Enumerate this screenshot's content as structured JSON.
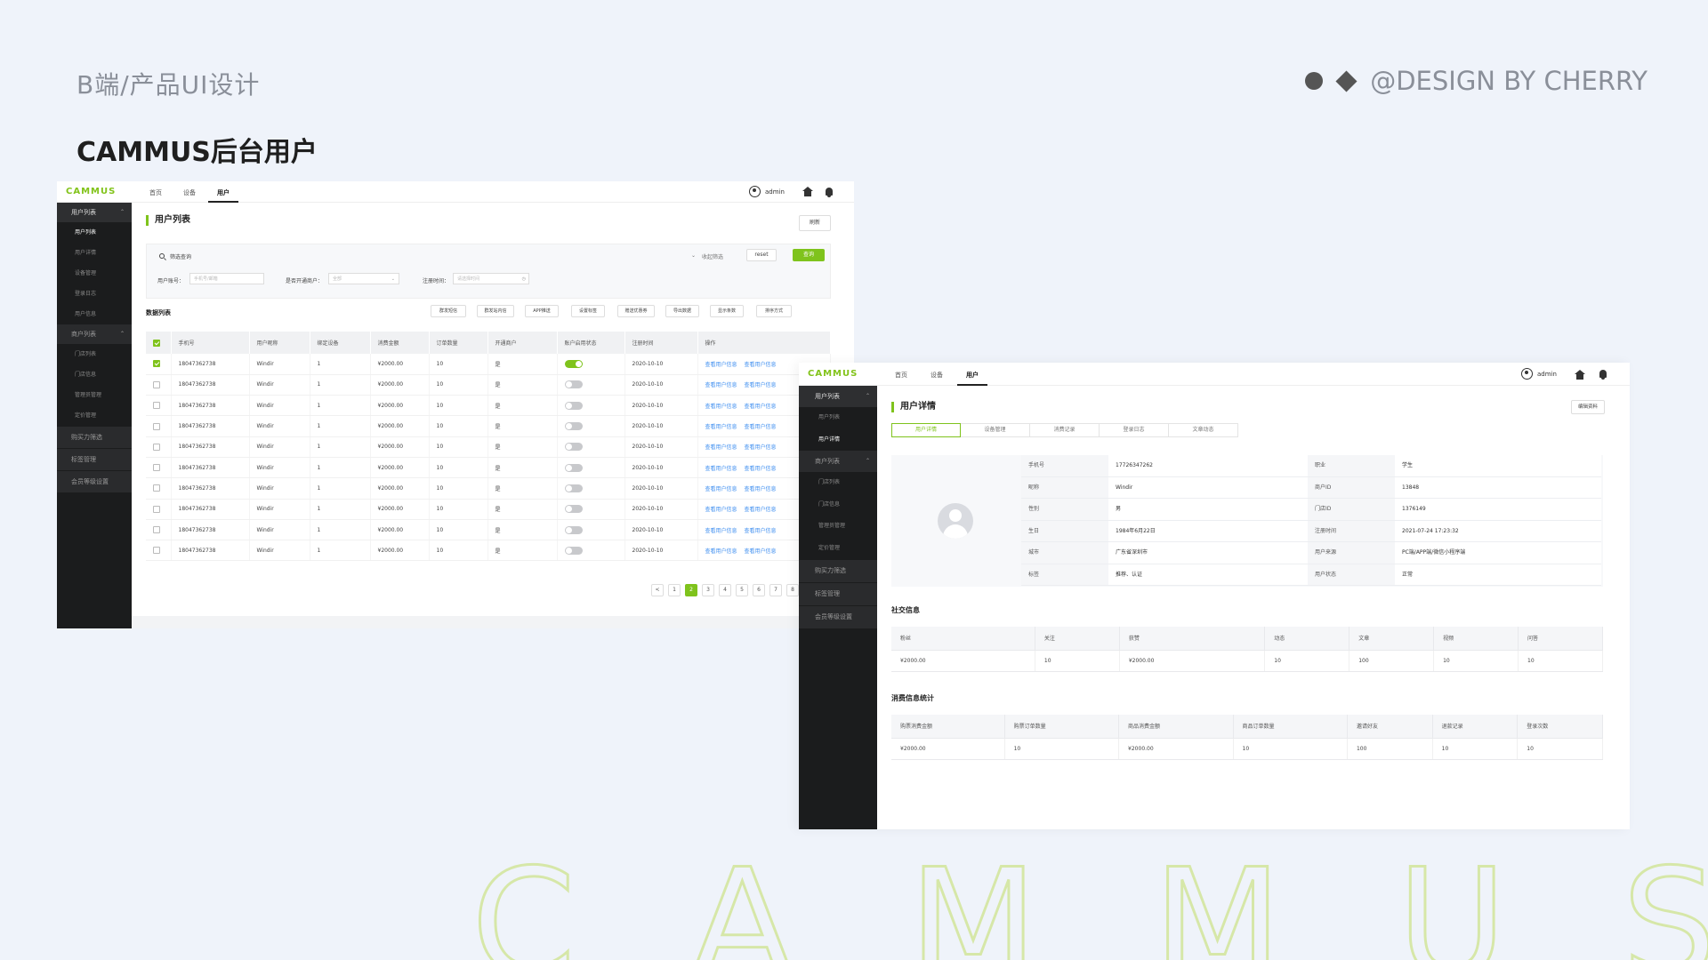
{
  "slide": {
    "subtitle": "B端/产品UI设计",
    "title": "CAMMUS后台用户",
    "signature": "@DESIGN BY CHERRY",
    "bg_letters": [
      "C",
      "A",
      "M",
      "M",
      "U",
      "S"
    ]
  },
  "colors": {
    "accent": "#7fc31c",
    "link": "#3d8ef0",
    "sidebar": "#1b1c1d",
    "background": "#eff3fa"
  },
  "icons": [
    "search-icon",
    "user-avatar-icon",
    "home-icon",
    "bell-icon",
    "chevron-down-icon",
    "calendar-icon",
    "checkbox-icon",
    "toggle-switch",
    "avatar-placeholder-icon"
  ],
  "app": {
    "logo": "CAMMUS",
    "nav": [
      "首页",
      "设备",
      "用户"
    ],
    "active_nav": "用户",
    "user": "admin"
  },
  "list_window": {
    "sidebar": {
      "group1": "用户列表",
      "group1_items": [
        "用户列表",
        "用户详情",
        "设备管理",
        "登录日志",
        "用户信息"
      ],
      "group2": "商户列表",
      "group2_items": [
        "门店列表",
        "门店信息",
        "管理员管理",
        "定价管理"
      ],
      "plain": [
        "购买力筛选",
        "标签管理",
        "会员等级设置"
      ]
    },
    "page_title": "用户列表",
    "refresh_btn": "刷新",
    "filter": {
      "search_label": "筛选查询",
      "collapse": "收起筛选",
      "reset": "reset",
      "query": "查询",
      "account_label": "用户账号：",
      "account_placeholder": "手机号/邮箱",
      "merchant_label": "是否开通商户：",
      "merchant_value": "全部",
      "reg_label": "注册时间：",
      "reg_placeholder": "请选择时间"
    },
    "data_title": "数据列表",
    "actions": [
      "群发短信",
      "群发站内信",
      "APP推送",
      "设置标签",
      "赠送优惠券",
      "导出数据",
      "显示条数",
      "排序方式"
    ],
    "columns": [
      "手机号",
      "用户昵称",
      "绑定设备",
      "消费金额",
      "订单数量",
      "开通商户",
      "账户启用状态",
      "注册时间",
      "操作"
    ],
    "rows": [
      {
        "phone": "18047362738",
        "nick": "Windir",
        "dev": "1",
        "amount": "¥2000.00",
        "orders": "10",
        "merchant": "是",
        "on": true,
        "checked": true,
        "date": "2020-10-10"
      },
      {
        "phone": "18047362738",
        "nick": "Windir",
        "dev": "1",
        "amount": "¥2000.00",
        "orders": "10",
        "merchant": "是",
        "on": false,
        "checked": false,
        "date": "2020-10-10"
      },
      {
        "phone": "18047362738",
        "nick": "Windir",
        "dev": "1",
        "amount": "¥2000.00",
        "orders": "10",
        "merchant": "是",
        "on": false,
        "checked": false,
        "date": "2020-10-10"
      },
      {
        "phone": "18047362738",
        "nick": "Windir",
        "dev": "1",
        "amount": "¥2000.00",
        "orders": "10",
        "merchant": "是",
        "on": false,
        "checked": false,
        "date": "2020-10-10"
      },
      {
        "phone": "18047362738",
        "nick": "Windir",
        "dev": "1",
        "amount": "¥2000.00",
        "orders": "10",
        "merchant": "是",
        "on": false,
        "checked": false,
        "date": "2020-10-10"
      },
      {
        "phone": "18047362738",
        "nick": "Windir",
        "dev": "1",
        "amount": "¥2000.00",
        "orders": "10",
        "merchant": "是",
        "on": false,
        "checked": false,
        "date": "2020-10-10"
      },
      {
        "phone": "18047362738",
        "nick": "Windir",
        "dev": "1",
        "amount": "¥2000.00",
        "orders": "10",
        "merchant": "是",
        "on": false,
        "checked": false,
        "date": "2020-10-10"
      },
      {
        "phone": "18047362738",
        "nick": "Windir",
        "dev": "1",
        "amount": "¥2000.00",
        "orders": "10",
        "merchant": "是",
        "on": false,
        "checked": false,
        "date": "2020-10-10"
      },
      {
        "phone": "18047362738",
        "nick": "Windir",
        "dev": "1",
        "amount": "¥2000.00",
        "orders": "10",
        "merchant": "是",
        "on": false,
        "checked": false,
        "date": "2020-10-10"
      },
      {
        "phone": "18047362738",
        "nick": "Windir",
        "dev": "1",
        "amount": "¥2000.00",
        "orders": "10",
        "merchant": "是",
        "on": false,
        "checked": false,
        "date": "2020-10-10"
      }
    ],
    "row_links": [
      "查看用户信息",
      "查看用户信息"
    ],
    "pagination": {
      "prev": "<",
      "pages": [
        "1",
        "2",
        "3",
        "4",
        "5",
        "6",
        "7",
        "8"
      ],
      "current": "2"
    }
  },
  "detail_window": {
    "sidebar": {
      "group1": "用户列表",
      "group1_items": [
        "用户列表",
        "用户详情"
      ],
      "group2": "商户列表",
      "group2_items": [
        "门店列表",
        "门店信息",
        "管理员管理",
        "定价管理"
      ],
      "plain": [
        "购买力筛选",
        "标签管理",
        "会员等级设置"
      ]
    },
    "page_title": "用户详情",
    "edit_btn": "编辑资料",
    "tabs": [
      "用户详情",
      "设备管理",
      "消费记录",
      "登录日志",
      "文章动态"
    ],
    "active_tab": "用户详情",
    "fields": [
      [
        "手机号",
        "17726347262",
        "职业",
        "学生"
      ],
      [
        "昵称",
        "Windir",
        "商户ID",
        "13848"
      ],
      [
        "性别",
        "男",
        "门店ID",
        "1376149"
      ],
      [
        "生日",
        "1984年6月22日",
        "注册时间",
        "2021-07-24 17:23:32"
      ],
      [
        "城市",
        "广东省深圳市",
        "用户来源",
        "PC端/APP端/微信小程序端"
      ],
      [
        "标签",
        "推荐、认证",
        "用户状态",
        "正常"
      ]
    ],
    "social": {
      "title": "社交信息",
      "headers": [
        "粉丝",
        "关注",
        "获赞",
        "动态",
        "文章",
        "视频",
        "问答"
      ],
      "values": [
        "¥2000.00",
        "10",
        "¥2000.00",
        "10",
        "100",
        "10",
        "10"
      ]
    },
    "consume": {
      "title": "消费信息统计",
      "headers": [
        "购票消费金额",
        "购票订单数量",
        "商品消费金额",
        "商品订单数量",
        "邀请好友",
        "退款记录",
        "登录次数"
      ],
      "values": [
        "¥2000.00",
        "10",
        "¥2000.00",
        "10",
        "100",
        "10",
        "10"
      ]
    }
  }
}
